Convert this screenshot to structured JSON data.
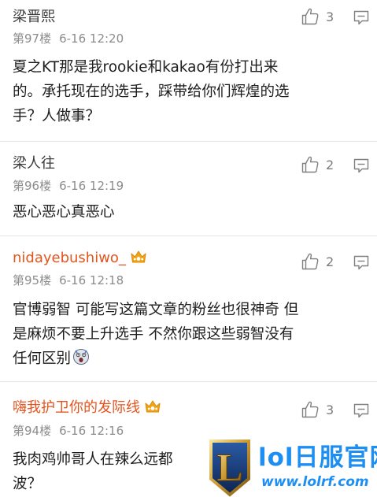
{
  "comments": [
    {
      "user": "梁晋熙",
      "floor": "第97楼",
      "time": "6-16 12:20",
      "likes": "3",
      "lines": [
        "夏之KT那是我rookie和kakao有份打出来",
        "的。承托现在的选手，踩带给你们辉煌的选",
        "手？人做事？"
      ]
    },
    {
      "user": "梁人往",
      "floor": "第96楼",
      "time": "6-16 12:19",
      "likes": "2",
      "lines": [
        "恶心恶心真恶心"
      ]
    },
    {
      "user": "nidayebushiwo_",
      "floor": "第95楼",
      "time": "6-16 12:18",
      "likes": "2",
      "lines": [
        "官博弱智 可能写这篇文章的粉丝也很神奇 但",
        "是麻烦不要上升选手 不然你跟这些弱智没有",
        "任何区别"
      ]
    },
    {
      "user": "嗨我护卫你的发际线",
      "floor": "第94楼",
      "time": "6-16 12:16",
      "likes": "3",
      "lines": [
        "我肉鸡帅哥人在辣么远都",
        "波？"
      ]
    }
  ],
  "watermark": {
    "logo_letter": "L",
    "title": "lol日服官网",
    "url": "www.lolrf.com"
  },
  "colors": {
    "vip_name": "#e6541e",
    "meta": "#8c8c8c",
    "watermark": "#1d8ff2",
    "crown": "#f2a516"
  }
}
